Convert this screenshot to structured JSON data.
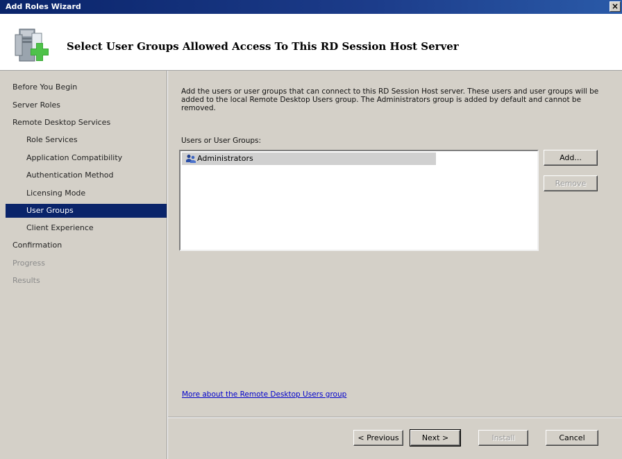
{
  "window": {
    "title": "Add Roles Wizard",
    "close_label": "×"
  },
  "header": {
    "title": "Select User Groups Allowed Access To This RD Session Host Server",
    "icon": "server-add-icon"
  },
  "nav": {
    "items": [
      {
        "label": "Before You Begin",
        "level": 1,
        "state": "normal"
      },
      {
        "label": "Server Roles",
        "level": 1,
        "state": "normal"
      },
      {
        "label": "Remote Desktop Services",
        "level": 1,
        "state": "normal"
      },
      {
        "label": "Role Services",
        "level": 2,
        "state": "normal"
      },
      {
        "label": "Application Compatibility",
        "level": 2,
        "state": "normal"
      },
      {
        "label": "Authentication Method",
        "level": 2,
        "state": "normal"
      },
      {
        "label": "Licensing Mode",
        "level": 2,
        "state": "normal"
      },
      {
        "label": "User Groups",
        "level": 2,
        "state": "selected"
      },
      {
        "label": "Client Experience",
        "level": 2,
        "state": "normal"
      },
      {
        "label": "Confirmation",
        "level": 1,
        "state": "normal"
      },
      {
        "label": "Progress",
        "level": 1,
        "state": "disabled"
      },
      {
        "label": "Results",
        "level": 1,
        "state": "disabled"
      }
    ]
  },
  "content": {
    "description": "Add the users or user groups that can connect to this RD Session Host server. These users and user groups will be added to the local Remote Desktop Users group. The Administrators group is added by default and cannot be removed.",
    "list_label": "Users or User Groups:",
    "groups": [
      {
        "name": "Administrators",
        "icon": "user-group-icon"
      }
    ],
    "add_label": "Add...",
    "remove_label": "Remove",
    "more_link": "More about the Remote Desktop Users group"
  },
  "footer": {
    "previous_label": "< Previous",
    "next_label": "Next >",
    "install_label": "Install",
    "cancel_label": "Cancel"
  },
  "colors": {
    "selection": "#0a246a",
    "titlebar": "#0a246a",
    "link": "#0000cc"
  }
}
